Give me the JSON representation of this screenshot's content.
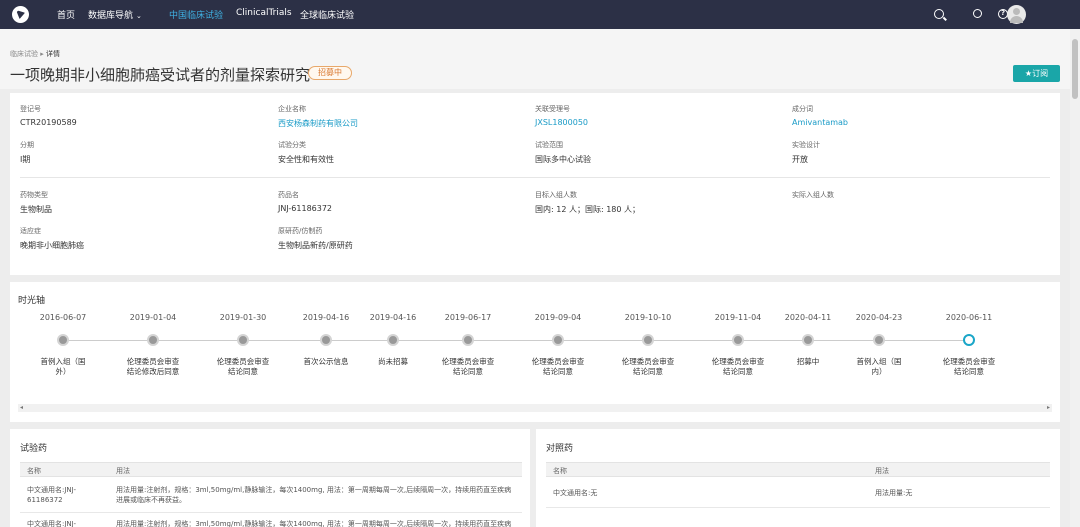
{
  "nav": {
    "home": "首页",
    "db_nav": "数据库导航",
    "china_trials": "中国临床试验",
    "clinical_trials": "ClinicalTrials",
    "global_trials": "全球临床试验"
  },
  "breadcrumb": {
    "parent": "临床试验",
    "separator": "▸",
    "current": "详情"
  },
  "title": "一项晚期非小细胞肺癌受试者的剂量探索研究",
  "status": "招募中",
  "subscribe": "★订阅",
  "info": {
    "reg_no": {
      "label": "登记号",
      "value": "CTR20190589"
    },
    "company": {
      "label": "企业名称",
      "value": "西安杨森制药有限公司"
    },
    "accept_no": {
      "label": "关联受理号",
      "value": "JXSL1800050"
    },
    "ingredient": {
      "label": "成分词",
      "value": "Amivantamab"
    },
    "phase": {
      "label": "分期",
      "value": "I期"
    },
    "category": {
      "label": "试验分类",
      "value": "安全性和有效性"
    },
    "scope": {
      "label": "试验范围",
      "value": "国际多中心试验"
    },
    "design": {
      "label": "实验设计",
      "value": "开放"
    },
    "drug_type": {
      "label": "药物类型",
      "value": "生物制品"
    },
    "drug_name": {
      "label": "药品名",
      "value": "JNJ-61186372"
    },
    "target_enroll": {
      "label": "目标入组人数",
      "value": "国内: 12 人；国际: 180 人；"
    },
    "actual_enroll": {
      "label": "实际入组人数",
      "value": ""
    },
    "indication": {
      "label": "适应症",
      "value": "晚期非小细胞肺癌"
    },
    "origin": {
      "label": "原研药/仿制药",
      "value": "生物制品新药/原研药"
    }
  },
  "timeline": {
    "title": "时光轴",
    "events": [
      {
        "date": "2016-06-07",
        "label": "首例入组（国外）"
      },
      {
        "date": "2019-01-04",
        "label": "伦理委员会审查结论修改后同意"
      },
      {
        "date": "2019-01-30",
        "label": "伦理委员会审查结论同意"
      },
      {
        "date": "2019-04-16",
        "label": "首次公示信息"
      },
      {
        "date": "2019-04-16",
        "label": "尚未招募"
      },
      {
        "date": "2019-06-17",
        "label": "伦理委员会审查结论同意"
      },
      {
        "date": "2019-09-04",
        "label": "伦理委员会审查结论同意"
      },
      {
        "date": "2019-10-10",
        "label": "伦理委员会审查结论同意"
      },
      {
        "date": "2019-11-04",
        "label": "伦理委员会审查结论同意"
      },
      {
        "date": "2020-04-11",
        "label": "招募中"
      },
      {
        "date": "2020-04-23",
        "label": "首例入组（国内）"
      },
      {
        "date": "2020-06-11",
        "label": "伦理委员会审查结论同意"
      }
    ]
  },
  "trial_drug": {
    "title": "试验药",
    "col_name": "名称",
    "col_usage": "用法",
    "rows": [
      {
        "name": "中文通用名:JNJ-61186372",
        "usage": "用法用量:注射剂，规格：3ml,50mg/ml,静脉输注，每次1400mg, 用法：第一周期每周一次,后续隔周一次，持续用药直至疾病进展或临床不再获益。"
      },
      {
        "name": "中文通用名:JNJ-",
        "usage": "用法用量:注射剂，规格：3ml,50mg/ml,静脉输注，每次1400mg, 用法：第一周期每周一次,后续隔周一次，持续用药直至疾病"
      }
    ]
  },
  "control_drug": {
    "title": "对照药",
    "col_name": "名称",
    "col_usage": "用法",
    "rows": [
      {
        "name": "中文通用名:无",
        "usage": "用法用量:无"
      }
    ]
  }
}
